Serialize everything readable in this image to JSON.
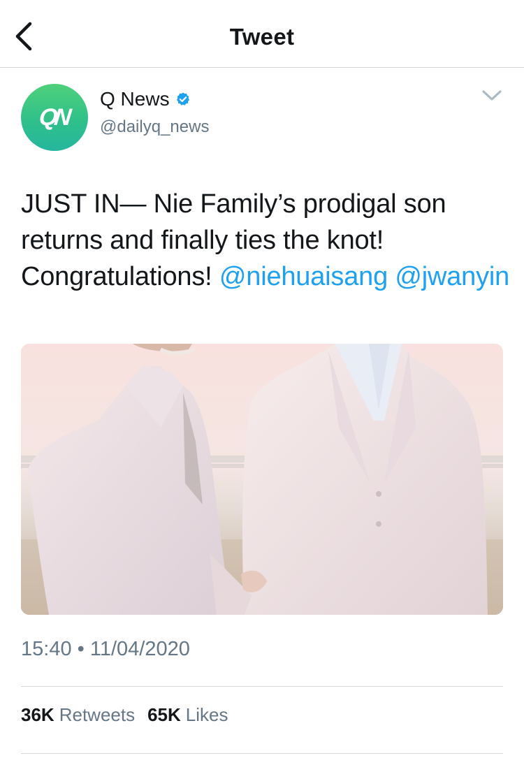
{
  "header": {
    "title": "Tweet",
    "back_icon": "chevron-left-icon"
  },
  "tweet": {
    "author": {
      "avatar_text": "QN",
      "display_name": "Q News",
      "handle": "@dailyq_news",
      "verified": true,
      "verified_icon": "verified-badge-icon"
    },
    "menu_icon": "chevron-down-icon",
    "text": {
      "body": "JUST IN— Nie Family’s prodigal son returns and finally ties the knot! Congratulations!",
      "mentions": [
        "@niehuaisang",
        "@jwanyin"
      ]
    },
    "media": {
      "kind": "photo"
    },
    "time": "15:40",
    "separator": "•",
    "date": "11/04/2020",
    "stats": {
      "retweets_count": "36K",
      "retweets_label": "Retweets",
      "likes_count": "65K",
      "likes_label": "Likes"
    }
  },
  "colors": {
    "accent": "#1da1f2",
    "text_primary": "#14171a",
    "text_secondary": "#657786",
    "divider": "#d3d6d9",
    "avatar_gradient_top": "#4fd17a",
    "avatar_gradient_bottom": "#25b69e"
  }
}
